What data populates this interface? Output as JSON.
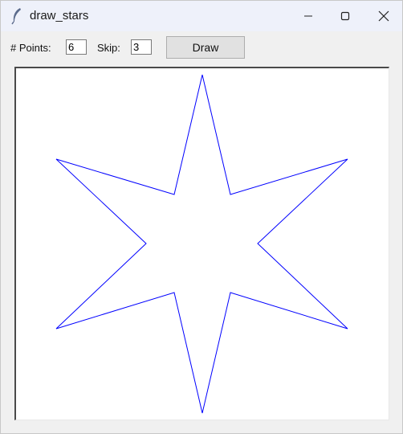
{
  "window": {
    "title": "draw_stars",
    "icon": "feather-icon",
    "controls": [
      "minimize-icon",
      "maximize-icon",
      "close-icon"
    ]
  },
  "toolbar": {
    "points_label": "# Points:",
    "points_value": "6",
    "skip_label": "Skip:",
    "skip_value": "3",
    "draw_label": "Draw"
  },
  "canvas": {
    "stroke_color": "#0000ff",
    "background": "#ffffff",
    "shape": "star",
    "star_points": 6
  }
}
